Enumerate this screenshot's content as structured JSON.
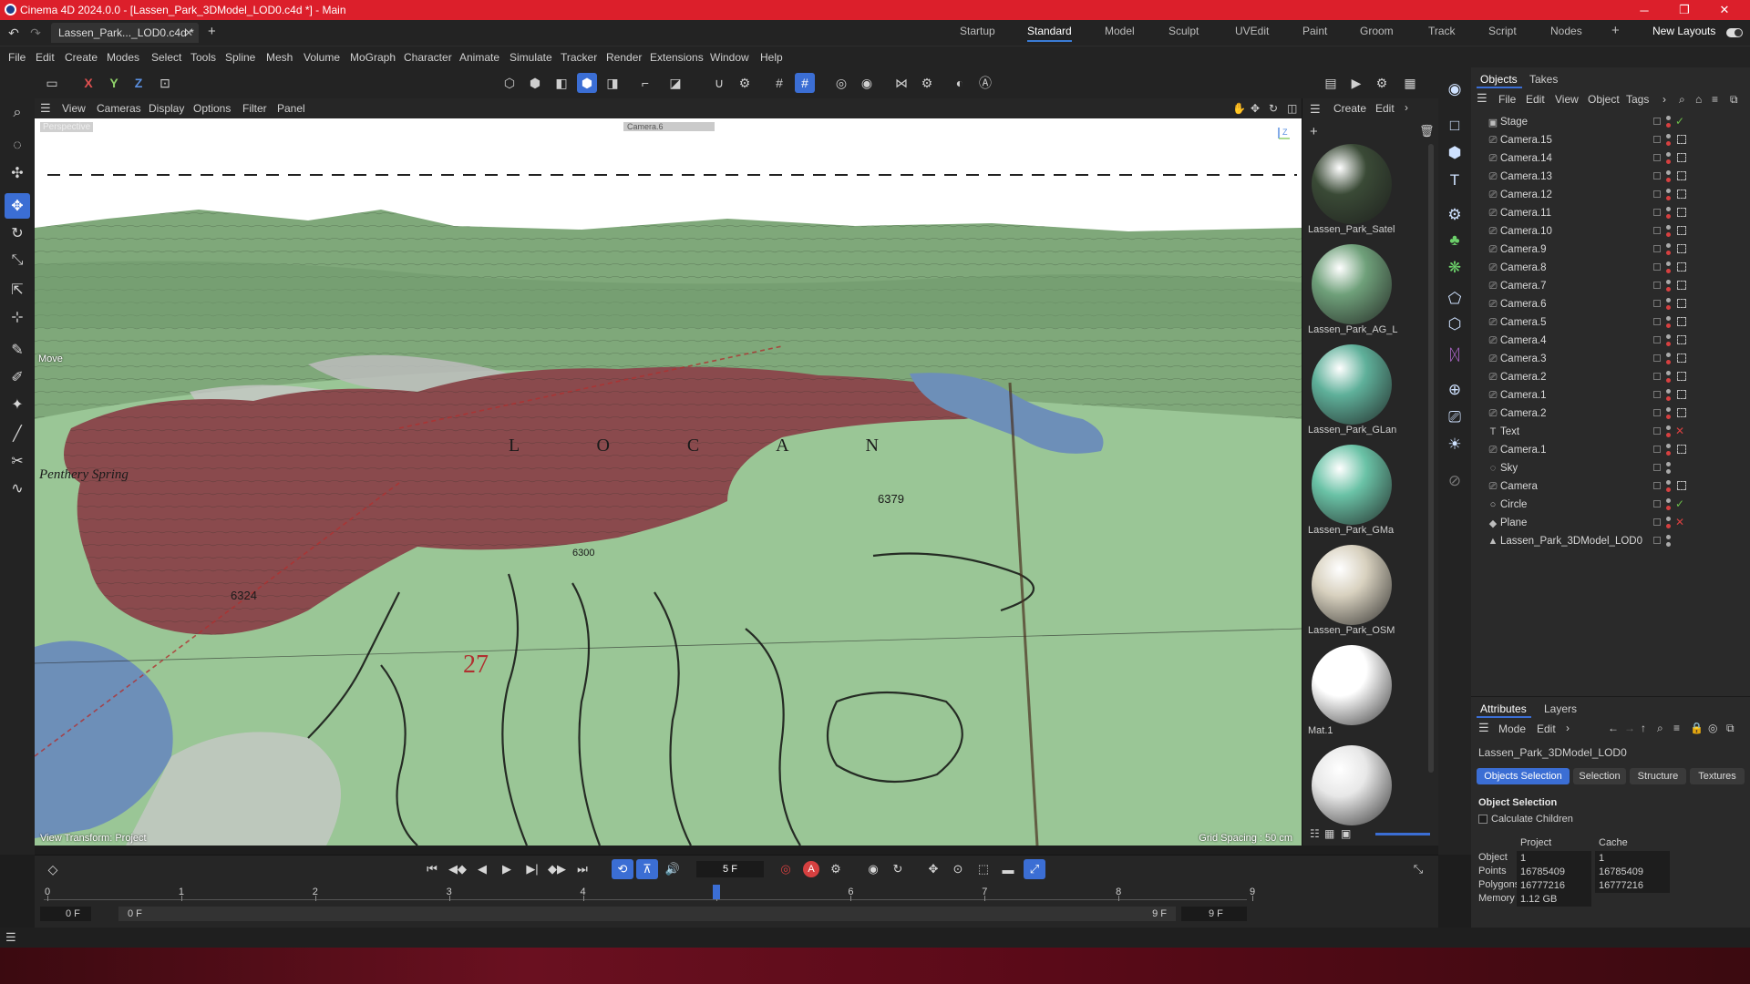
{
  "window": {
    "title": "Cinema 4D 2024.0.0 - [Lassen_Park_3DModel_LOD0.c4d *] - Main",
    "controls": [
      "─",
      "❐",
      "✕"
    ]
  },
  "doc_tab": {
    "label": "Lassen_Park..._LOD0.c4d *",
    "close": "✕",
    "add": "+"
  },
  "layouts": [
    "Startup",
    "Standard",
    "Model",
    "Sculpt",
    "UVEdit",
    "Paint",
    "Groom",
    "Track",
    "Script",
    "Nodes"
  ],
  "layouts_active": "Standard",
  "layout_add": "+",
  "new_layouts": "New Layouts",
  "menu": [
    "File",
    "Edit",
    "Create",
    "Modes",
    "Select",
    "Tools",
    "Spline",
    "Mesh",
    "Volume",
    "MoGraph",
    "Character",
    "Animate",
    "Simulate",
    "Tracker",
    "Render",
    "Extensions",
    "Window",
    "Help"
  ],
  "toolbar": {
    "axis_x": "X",
    "axis_y": "Y",
    "axis_z": "Z"
  },
  "view_menu": [
    "View",
    "Cameras",
    "Display",
    "Options",
    "Filter",
    "Panel"
  ],
  "viewport": {
    "label": "Perspective",
    "camera_label": "Camera.6",
    "mode_text": "Move",
    "status_left": "View Transform: Project",
    "status_right": "Grid Spacing : 50 cm",
    "map_labels": [
      "Penthery Spring",
      "L O C A N",
      "27",
      "6324",
      "6379",
      "6300"
    ]
  },
  "material_panel": {
    "menu": [
      "Create",
      "Edit"
    ],
    "materials": [
      {
        "name": "Lassen_Park_Satel",
        "color": "#3a4a36"
      },
      {
        "name": "Lassen_Park_AG_L",
        "color": "#6fa07a"
      },
      {
        "name": "Lassen_Park_GLan",
        "color": "#5fb09a"
      },
      {
        "name": "Lassen_Park_GMa",
        "color": "#6ac2a6"
      },
      {
        "name": "Lassen_Park_OSM",
        "color": "#d8d1bf"
      },
      {
        "name": "Mat.1",
        "color": "#ffffff"
      },
      {
        "name": "",
        "color": "#e8e8e8"
      }
    ]
  },
  "objects_panel": {
    "tabs": [
      "Objects",
      "Takes"
    ],
    "menu": [
      "File",
      "Edit",
      "View",
      "Object",
      "Tags"
    ],
    "items": [
      {
        "name": "Stage",
        "icon": "stage-icon",
        "flag": "check"
      },
      {
        "name": "Camera.15",
        "icon": "camera-icon",
        "flag": "tag"
      },
      {
        "name": "Camera.14",
        "icon": "camera-icon",
        "flag": "tag"
      },
      {
        "name": "Camera.13",
        "icon": "camera-icon",
        "flag": "tag"
      },
      {
        "name": "Camera.12",
        "icon": "camera-icon",
        "flag": "tag"
      },
      {
        "name": "Camera.11",
        "icon": "camera-icon",
        "flag": "tag"
      },
      {
        "name": "Camera.10",
        "icon": "camera-icon",
        "flag": "tag"
      },
      {
        "name": "Camera.9",
        "icon": "camera-icon",
        "flag": "tag"
      },
      {
        "name": "Camera.8",
        "icon": "camera-icon",
        "flag": "tag"
      },
      {
        "name": "Camera.7",
        "icon": "camera-icon",
        "flag": "tag"
      },
      {
        "name": "Camera.6",
        "icon": "camera-icon",
        "flag": "tag"
      },
      {
        "name": "Camera.5",
        "icon": "camera-icon",
        "flag": "tag"
      },
      {
        "name": "Camera.4",
        "icon": "camera-icon",
        "flag": "tag"
      },
      {
        "name": "Camera.3",
        "icon": "camera-icon",
        "flag": "tag"
      },
      {
        "name": "Camera.2",
        "icon": "camera-icon",
        "flag": "tag"
      },
      {
        "name": "Camera.1",
        "icon": "camera-icon",
        "flag": "tag"
      },
      {
        "name": "Camera.2",
        "icon": "camera-icon",
        "flag": "tag"
      },
      {
        "name": "Text",
        "icon": "text-icon",
        "flag": "x"
      },
      {
        "name": "Camera.1",
        "icon": "camera-icon",
        "flag": "tag"
      },
      {
        "name": "Sky",
        "icon": "sky-icon",
        "flag": "none"
      },
      {
        "name": "Camera",
        "icon": "camera-icon",
        "flag": "tag"
      },
      {
        "name": "Circle",
        "icon": "circle-icon",
        "flag": "check"
      },
      {
        "name": "Plane",
        "icon": "plane-icon",
        "flag": "x"
      },
      {
        "name": "Lassen_Park_3DModel_LOD0",
        "icon": "polygon-icon",
        "flag": "none"
      }
    ]
  },
  "attributes_panel": {
    "tabs": [
      "Attributes",
      "Layers"
    ],
    "menu": [
      "Mode",
      "Edit"
    ],
    "object_name": "Lassen_Park_3DModel_LOD0",
    "mode_buttons": [
      "Objects Selection",
      "Selection",
      "Structure",
      "Textures"
    ],
    "section": "Object Selection",
    "calculate_children": "Calculate Children",
    "columns": [
      "Project",
      "Cache"
    ],
    "rows": [
      {
        "key": "Object",
        "project": "1",
        "cache": "1"
      },
      {
        "key": "Points",
        "project": "16785409",
        "cache": "16785409"
      },
      {
        "key": "Polygons",
        "project": "16777216",
        "cache": "16777216"
      },
      {
        "key": "Memory",
        "project": "1.12 GB",
        "cache": ""
      }
    ]
  },
  "timeline": {
    "current_frame": "5 F",
    "ticks": [
      "0",
      "1",
      "2",
      "3",
      "4",
      "5",
      "6",
      "7",
      "8",
      "9"
    ],
    "playhead_frame": 5,
    "start_field": "0 F",
    "start_field2": "0 F",
    "end_field": "9 F",
    "end_field2": "9 F"
  },
  "colors": {
    "accent": "#3b6ed4",
    "titlebar": "#dc1f2b",
    "terrain_green": "#8fbf8a",
    "burn_area": "#8a4a4d",
    "water": "#6d8fb8"
  }
}
